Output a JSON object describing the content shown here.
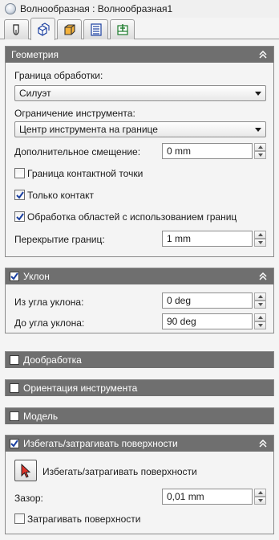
{
  "window": {
    "title": "Волнообразная : Волнообразная1",
    "title_icon": "sphere-icon"
  },
  "tabs": [
    {
      "icon": "tool-icon",
      "active": false
    },
    {
      "icon": "cube-stack-icon",
      "active": true
    },
    {
      "icon": "stock-block-icon",
      "active": false
    },
    {
      "icon": "list-icon",
      "active": false
    },
    {
      "icon": "output-icon",
      "active": false
    }
  ],
  "geometry": {
    "title": "Геометрия",
    "machining_boundary_label": "Граница обработки:",
    "machining_boundary_value": "Силуэт",
    "tool_limit_label": "Ограничение инструмента:",
    "tool_limit_value": "Центр инструмента на границе",
    "additional_offset_label": "Дополнительное смещение:",
    "additional_offset_value": "0 mm",
    "contact_point_boundary_label": "Граница контактной точки",
    "contact_point_boundary_checked": false,
    "contact_only_label": "Только контакт",
    "contact_only_checked": true,
    "rest_areas_label": "Обработка областей с использованием границ",
    "rest_areas_checked": true,
    "boundary_overlap_label": "Перекрытие границ:",
    "boundary_overlap_value": "1 mm"
  },
  "slope": {
    "title": "Уклон",
    "checked": true,
    "from_angle_label": "Из угла уклона:",
    "from_angle_value": "0 deg",
    "to_angle_label": "До угла уклона:",
    "to_angle_value": "90 deg"
  },
  "rest_machining": {
    "title": "Дообработка",
    "checked": false
  },
  "tool_orientation": {
    "title": "Ориентация инструмента",
    "checked": false
  },
  "model": {
    "title": "Модель",
    "checked": false
  },
  "avoid_touch": {
    "title": "Избегать/затрагивать поверхности",
    "checked": true,
    "select_button_label": "Избегать/затрагивать поверхности",
    "clearance_label": "Зазор:",
    "clearance_value": "0,01 mm",
    "touch_surfaces_label": "Затрагивать поверхности",
    "touch_surfaces_checked": false
  }
}
